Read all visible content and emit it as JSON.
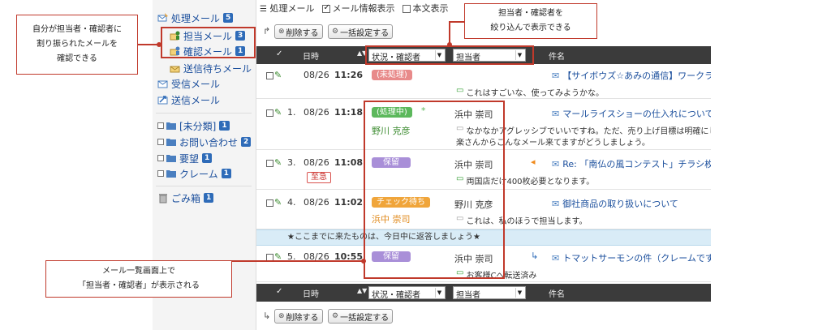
{
  "sidebar": {
    "processing": {
      "label": "処理メール",
      "count": "5"
    },
    "assigned": {
      "label": "担当メール",
      "count": "3"
    },
    "confirm": {
      "label": "確認メール",
      "count": "1"
    },
    "waiting": {
      "label": "送信待ちメール"
    },
    "received": {
      "label": "受信メール"
    },
    "sent": {
      "label": "送信メール"
    },
    "folders": [
      {
        "label": "[未分類]",
        "count": "1"
      },
      {
        "label": "お問い合わせ",
        "count": "2"
      },
      {
        "label": "要望",
        "count": "1"
      },
      {
        "label": "クレーム",
        "count": "1"
      }
    ],
    "trash": {
      "label": "ごみ箱",
      "count": "1"
    }
  },
  "toolbar": {
    "title": "処理メール",
    "show_info": "メール情報表示",
    "show_body": "本文表示",
    "delete": "削除する",
    "bulk": "一括設定する"
  },
  "table": {
    "col_date": "日時",
    "filter_status": "状況・確認者",
    "filter_assignee": "担当者",
    "col_subject": "件名",
    "rows": [
      {
        "num": "",
        "date": "08/26",
        "time": "11:26",
        "status": "(未処理)",
        "status_color": "#e88a8a",
        "subject": "【サイボウズ☆あみの通信】ワークライ",
        "comment": "これはすごいな、使ってみようかな。"
      },
      {
        "num": "1.",
        "date": "08/26",
        "time": "11:18",
        "status": "(処理中)",
        "status_color": "#5cb85c",
        "mark": "*",
        "confirmer": "野川 克彦",
        "assignee": "浜中 崇司",
        "subject": "マールライスショーの仕入れについて",
        "comment_line1": "なかなかアグレッシブでいいですね。ただ、売り上げ目標は明確にしても",
        "comment_line2": "楽さんからこんなメール来てますがどうしましょう。"
      },
      {
        "num": "3.",
        "date": "08/26",
        "time": "11:08",
        "status": "保留",
        "status_color": "#a98fd8",
        "assignee": "浜中 崇司",
        "urgent": "至急",
        "subject": "Re: 「南仏の風コンテスト」チラシ枚数",
        "comment": "両国店だけ400枚必要となります。"
      },
      {
        "num": "4.",
        "date": "08/26",
        "time": "11:02",
        "status": "チェック待ち",
        "status_color": "#f0a53a",
        "confirmer": "浜中 崇司",
        "assignee": "野川 克彦",
        "subject": "御社商品の取り扱いについて",
        "comment": "これは、私のほうで担当します。"
      },
      {
        "num": "5.",
        "date": "08/26",
        "time": "10:55",
        "status": "保留",
        "status_color": "#a98fd8",
        "assignee": "浜中 崇司",
        "subject": "トマットサーモンの件（クレームです）",
        "comment": "お客様Cへ転送済み"
      }
    ]
  },
  "banner": "★ここまでに来たものは、今日中に返答しましょう★",
  "annotations": {
    "left_line1": "自分が担当者・確認者に",
    "left_line2": "割り振られたメールを",
    "left_line3": "確認できる",
    "top_line1": "担当者・確認者を",
    "top_line2": "絞り込んで表示できる",
    "bottom_line1": "メール一覧画面上で",
    "bottom_line2": "「担当者・確認者」が表示される"
  },
  "colors": {
    "accent": "#c0392b",
    "header": "#3b3b3b",
    "banner": "#d9ecf7",
    "link": "#1a4e9c"
  }
}
